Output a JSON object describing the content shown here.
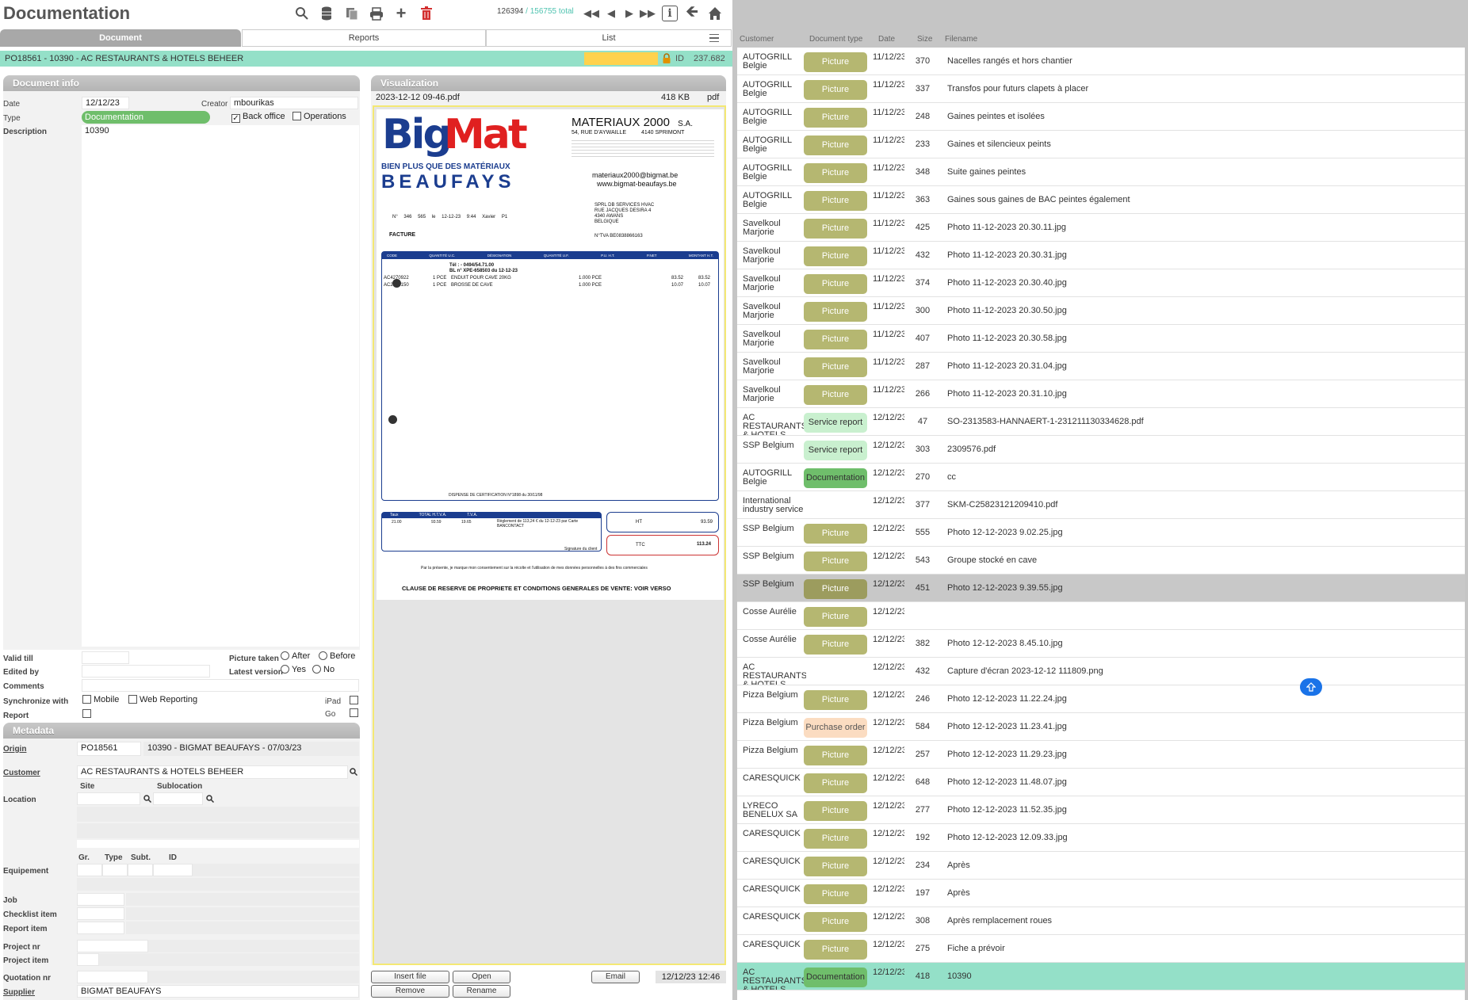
{
  "app": {
    "title": "Documentation",
    "record_counter": "126394",
    "record_total": "/ 156755 total"
  },
  "tabs": [
    {
      "label": "Document"
    },
    {
      "label": "Reports"
    },
    {
      "label": "List"
    }
  ],
  "record_bar": {
    "title": "PO18561 - 10390 - AC RESTAURANTS & HOTELS BEHEER",
    "id_label": "ID",
    "id_value": "237.682"
  },
  "doc_info": {
    "header": "Document info",
    "date_label": "Date",
    "date": "12/12/23",
    "creator_label": "Creator",
    "creator": "mbourikas",
    "type_label": "Type",
    "type": "Documentation",
    "back_office_label": "Back office",
    "operations_label": "Operations",
    "description_label": "Description",
    "description": "10390",
    "valid_till_label": "Valid till",
    "edited_by_label": "Edited by",
    "comments_label": "Comments",
    "picture_taken_label": "Picture taken",
    "after_label": "After",
    "before_label": "Before",
    "latest_version_label": "Latest version",
    "yes_label": "Yes",
    "no_label": "No",
    "sync_label": "Synchronize with",
    "mobile_label": "Mobile",
    "web_reporting_label": "Web Reporting",
    "ipad_label": "iPad",
    "report_label": "Report",
    "go_label": "Go"
  },
  "metadata": {
    "header": "Metadata",
    "origin_label": "Origin",
    "origin_code": "PO18561",
    "origin_desc": "10390 - BIGMAT BEAUFAYS - 07/03/23",
    "customer_label": "Customer",
    "customer": "AC RESTAURANTS & HOTELS BEHEER",
    "site_label": "Site",
    "sublocation_label": "Sublocation",
    "location_label": "Location",
    "gr_label": "Gr.",
    "type_label": "Type",
    "subt_label": "Subt.",
    "id_label": "ID",
    "equipment_label": "Equipement",
    "job_label": "Job",
    "checklist_label": "Checklist item",
    "report_item_label": "Report item",
    "project_nr_label": "Project nr",
    "project_item_label": "Project item",
    "quotation_label": "Quotation nr",
    "supplier_label": "Supplier",
    "supplier": "BIGMAT BEAUFAYS"
  },
  "visualization": {
    "header": "Visualization",
    "filename": "2023-12-12 09-46.pdf",
    "size": "418 KB",
    "ext": "pdf",
    "doc": {
      "brand_big": "Big",
      "brand_mat": "Mat",
      "tagline": "BIEN PLUS QUE DES MATÉRIAUX",
      "city": "BEAUFAYS",
      "company": "MATERIAUX  2000",
      "company_sa": "S.A.",
      "street": "54, RUE D'AYWAILLE",
      "postal": "4140  SPRIMONT",
      "email": "materiaux2000@bigmat.be",
      "web": "www.bigmat-beaufays.be",
      "inv_no": "N° 346 565",
      "inv_date": "le 12-12-23",
      "inv_time": "9:44",
      "inv_vendor": "Xavier",
      "inv_p": "P1",
      "facture": "FACTURE",
      "client_1": "SPRL DB SERVICES HVAC",
      "client_2": "RUE JACQUES DESIRA 4",
      "client_3": "4340 AWANS",
      "client_4": "BELGIQUE",
      "tva_label": "N°TVA  BE0838866163",
      "cols": [
        "CODE",
        "QUANTITÉ U.C.",
        "DÉSIGNATION",
        "QUANTITÉ U.F.",
        "P.U. H.T.",
        "P.NET",
        "MONTANT H.T."
      ],
      "tel": "Tél :  - 0494/54.71.00",
      "bl": "BL n° XPE-658503 du 12-12-23",
      "lines": [
        {
          "code": "AC4270922",
          "qty": "1 PCE",
          "desc": "ENDUIT POUR CAVE 20KG",
          "qtyf": "1.000 PCE",
          "pnet": "83.52",
          "amt": "83.52"
        },
        {
          "code": "AC2868150",
          "qty": "1 PCE",
          "desc": "BROSSE DE CAVE",
          "qtyf": "1.000 PCE",
          "pnet": "10.07",
          "amt": "10.07"
        }
      ],
      "dispense": "DISPENSE DE CERTIFICATION N°1898 du 30/11/98",
      "tot_cols": [
        "Taux",
        "TOTAL H.T.V.A.",
        "T.V.A."
      ],
      "tot_rate": "21.00",
      "tot_htva": "93.59",
      "tot_tva": "19.65",
      "reglement": "Règlement de 113,24 € du 12-12-23 par Carte BANCONTACT",
      "ht_label": "HT",
      "ht_value": "93.59",
      "ttc_label": "TTC",
      "ttc_value": "113.24",
      "signature": "Signature du client",
      "consent": "Par la présente, je marque mon consentement sur la récolte et l'utilisation de mes données personnelles à des fins commerciales",
      "clause": "CLAUSE DE RESERVE DE PROPRIETE ET CONDITIONS GENERALES DE VENTE: VOIR VERSO"
    }
  },
  "buttons": {
    "insert_file": "Insert file",
    "open": "Open",
    "email": "Email",
    "remove": "Remove",
    "rename": "Rename",
    "timestamp": "12/12/23 12:46"
  },
  "list": {
    "headers": {
      "customer": "Customer",
      "doctype": "Document type",
      "date": "Date",
      "size": "Size",
      "filename": "Filename"
    },
    "rows": [
      {
        "customer": "AUTOGRILL Belgie",
        "doctype": "Picture",
        "date": "11/12/23",
        "size": "370",
        "filename": "Nacelles rangés et hors chantier"
      },
      {
        "customer": "AUTOGRILL Belgie",
        "doctype": "Picture",
        "date": "11/12/23",
        "size": "337",
        "filename": "Transfos pour futurs clapets à placer"
      },
      {
        "customer": "AUTOGRILL Belgie",
        "doctype": "Picture",
        "date": "11/12/23",
        "size": "248",
        "filename": "Gaines peintes et isolées"
      },
      {
        "customer": "AUTOGRILL Belgie",
        "doctype": "Picture",
        "date": "11/12/23",
        "size": "233",
        "filename": "Gaines et silencieux peints"
      },
      {
        "customer": "AUTOGRILL Belgie",
        "doctype": "Picture",
        "date": "11/12/23",
        "size": "348",
        "filename": "Suite gaines peintes"
      },
      {
        "customer": "AUTOGRILL Belgie",
        "doctype": "Picture",
        "date": "11/12/23",
        "size": "363",
        "filename": "Gaines sous gaines de BAC peintes également"
      },
      {
        "customer": "Savelkoul Marjorie",
        "doctype": "Picture",
        "date": "11/12/23",
        "size": "425",
        "filename": "Photo 11-12-2023 20.30.11.jpg"
      },
      {
        "customer": "Savelkoul Marjorie",
        "doctype": "Picture",
        "date": "11/12/23",
        "size": "432",
        "filename": "Photo 11-12-2023 20.30.31.jpg"
      },
      {
        "customer": "Savelkoul Marjorie",
        "doctype": "Picture",
        "date": "11/12/23",
        "size": "374",
        "filename": "Photo 11-12-2023 20.30.40.jpg"
      },
      {
        "customer": "Savelkoul Marjorie",
        "doctype": "Picture",
        "date": "11/12/23",
        "size": "300",
        "filename": "Photo 11-12-2023 20.30.50.jpg"
      },
      {
        "customer": "Savelkoul Marjorie",
        "doctype": "Picture",
        "date": "11/12/23",
        "size": "407",
        "filename": "Photo 11-12-2023 20.30.58.jpg"
      },
      {
        "customer": "Savelkoul Marjorie",
        "doctype": "Picture",
        "date": "11/12/23",
        "size": "287",
        "filename": "Photo 11-12-2023 20.31.04.jpg"
      },
      {
        "customer": "Savelkoul Marjorie",
        "doctype": "Picture",
        "date": "11/12/23",
        "size": "266",
        "filename": "Photo 11-12-2023 20.31.10.jpg"
      },
      {
        "customer": "AC RESTAURANTS & HOTELS",
        "doctype": "Service report",
        "date": "12/12/23",
        "size": "47",
        "filename": "SO-2313583-HANNAERT-1-231211130334628.pdf"
      },
      {
        "customer": "SSP Belgium",
        "doctype": "Service report",
        "date": "12/12/23",
        "size": "303",
        "filename": "2309576.pdf"
      },
      {
        "customer": "AUTOGRILL Belgie",
        "doctype": "Documentation",
        "date": "12/12/23",
        "size": "270",
        "filename": "cc"
      },
      {
        "customer": "International industry service",
        "doctype": "",
        "date": "12/12/23",
        "size": "377",
        "filename": "SKM-C25823121209410.pdf"
      },
      {
        "customer": "SSP Belgium",
        "doctype": "Picture",
        "date": "12/12/23",
        "size": "555",
        "filename": "Photo 12-12-2023 9.02.25.jpg"
      },
      {
        "customer": "SSP Belgium",
        "doctype": "Picture",
        "date": "12/12/23",
        "size": "543",
        "filename": "Groupe stocké en cave"
      },
      {
        "customer": "SSP Belgium",
        "doctype": "Picture",
        "date": "12/12/23",
        "size": "451",
        "filename": "Photo 12-12-2023 9.39.55.jpg"
      },
      {
        "customer": "Cosse Aurélie",
        "doctype": "Picture",
        "date": "12/12/23",
        "size": "",
        "filename": ""
      },
      {
        "customer": "Cosse Aurélie",
        "doctype": "Picture",
        "date": "12/12/23",
        "size": "382",
        "filename": "Photo 12-12-2023 8.45.10.jpg"
      },
      {
        "customer": "AC RESTAURANTS & HOTELS",
        "doctype": "",
        "date": "12/12/23",
        "size": "432",
        "filename": "Capture d'écran 2023-12-12 111809.png"
      },
      {
        "customer": "Pizza Belgium",
        "doctype": "Picture",
        "date": "12/12/23",
        "size": "246",
        "filename": "Photo 12-12-2023 11.22.24.jpg"
      },
      {
        "customer": "Pizza Belgium",
        "doctype": "Purchase order",
        "date": "12/12/23",
        "size": "584",
        "filename": "Photo 12-12-2023 11.23.41.jpg"
      },
      {
        "customer": "Pizza Belgium",
        "doctype": "Picture",
        "date": "12/12/23",
        "size": "257",
        "filename": "Photo 12-12-2023 11.29.23.jpg"
      },
      {
        "customer": "CARESQUICK",
        "doctype": "Picture",
        "date": "12/12/23",
        "size": "648",
        "filename": "Photo 12-12-2023 11.48.07.jpg"
      },
      {
        "customer": "LYRECO BENELUX SA",
        "doctype": "Picture",
        "date": "12/12/23",
        "size": "277",
        "filename": "Photo 12-12-2023 11.52.35.jpg"
      },
      {
        "customer": "CARESQUICK",
        "doctype": "Picture",
        "date": "12/12/23",
        "size": "192",
        "filename": "Photo 12-12-2023 12.09.33.jpg"
      },
      {
        "customer": "CARESQUICK",
        "doctype": "Picture",
        "date": "12/12/23",
        "size": "234",
        "filename": "Après"
      },
      {
        "customer": "CARESQUICK",
        "doctype": "Picture",
        "date": "12/12/23",
        "size": "197",
        "filename": "Après"
      },
      {
        "customer": "CARESQUICK",
        "doctype": "Picture",
        "date": "12/12/23",
        "size": "308",
        "filename": "Après remplacement roues"
      },
      {
        "customer": "CARESQUICK",
        "doctype": "Picture",
        "date": "12/12/23",
        "size": "275",
        "filename": "Fiche a prévoir"
      },
      {
        "customer": "AC RESTAURANTS & HOTELS",
        "doctype": "Documentation",
        "date": "12/12/23",
        "size": "418",
        "filename": "10390"
      }
    ],
    "selected_grey_index": 19,
    "selected_index": 33
  },
  "colors": {
    "picture": "#b5b771",
    "service_report": "#c9f0cf",
    "documentation": "#6fbe6b",
    "purchase_order": "#fbdcc1",
    "teal": "#94e0c8",
    "yellow_field": "#ffd24d",
    "accent_blue": "#1a73e8"
  }
}
